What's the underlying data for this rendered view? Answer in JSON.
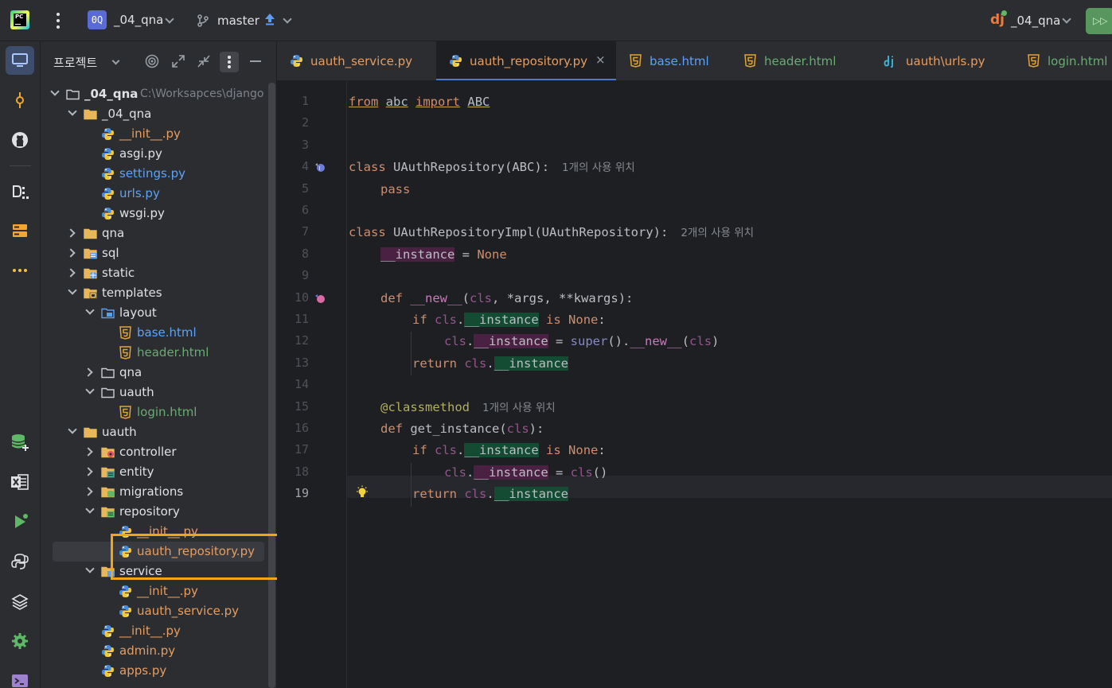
{
  "titlebar": {
    "project_badge": "0Q",
    "project_name": "_04_qna",
    "branch": "master",
    "run_config": "_04_qna"
  },
  "panel": {
    "title": "프로젝트"
  },
  "tree": [
    {
      "label": "_04_qna",
      "path": "C:\\Worksapces\\django"
    },
    {
      "label": "_04_qna"
    },
    {
      "label": "__init__.py"
    },
    {
      "label": "asgi.py"
    },
    {
      "label": "settings.py"
    },
    {
      "label": "urls.py"
    },
    {
      "label": "wsgi.py"
    },
    {
      "label": "qna"
    },
    {
      "label": "sql"
    },
    {
      "label": "static"
    },
    {
      "label": "templates"
    },
    {
      "label": "layout"
    },
    {
      "label": "base.html"
    },
    {
      "label": "header.html"
    },
    {
      "label": "qna"
    },
    {
      "label": "uauth"
    },
    {
      "label": "login.html"
    },
    {
      "label": "uauth"
    },
    {
      "label": "controller"
    },
    {
      "label": "entity"
    },
    {
      "label": "migrations"
    },
    {
      "label": "repository"
    },
    {
      "label": "__init__.py"
    },
    {
      "label": "uauth_repository.py"
    },
    {
      "label": "service"
    },
    {
      "label": "__init__.py"
    },
    {
      "label": "uauth_service.py"
    },
    {
      "label": "__init__.py"
    },
    {
      "label": "admin.py"
    },
    {
      "label": "apps.py"
    }
  ],
  "tabs": [
    {
      "label": "uauth_service.py"
    },
    {
      "label": "uauth_repository.py",
      "close": "×"
    },
    {
      "label": "base.html"
    },
    {
      "label": "header.html"
    },
    {
      "label": "uauth\\urls.py"
    },
    {
      "label": "login.html"
    }
  ],
  "editor": {
    "line_numbers": [
      "1",
      "2",
      "3",
      "4",
      "5",
      "6",
      "7",
      "8",
      "9",
      "10",
      "11",
      "12",
      "13",
      "14",
      "15",
      "16",
      "17",
      "18",
      "19"
    ],
    "hints": {
      "l4": "1개의 사용 위치",
      "l7": "2개의 사용 위치",
      "l15": "1개의 사용 위치"
    },
    "tokens": {
      "from": "from",
      "abc": "abc",
      "import": "import",
      "ABC": "ABC",
      "class": "class",
      "UAuthRepository": "UAuthRepository",
      "UAuthRepositoryImpl": "UAuthRepositoryImpl",
      "pass": "pass",
      "instance": "__instance",
      "None": "None",
      "def": "def",
      "new": "__new__",
      "cls": "cls",
      "args": "*args",
      "kwargs": "**kwargs",
      "if": "if",
      "is": "is",
      "super": "super",
      "return": "return",
      "classmethod": "@classmethod",
      "get_instance": "get_instance",
      "eq": " = ",
      "colon": ":",
      "comma": ", ",
      "dot": ".",
      "lp": "(",
      "rp": ")",
      "unit": "()"
    }
  },
  "colors": {
    "accent": "#4d78cc",
    "highlight_box": "#f2a516",
    "read_usage": "#134b33",
    "write_usage": "#4a2142"
  }
}
